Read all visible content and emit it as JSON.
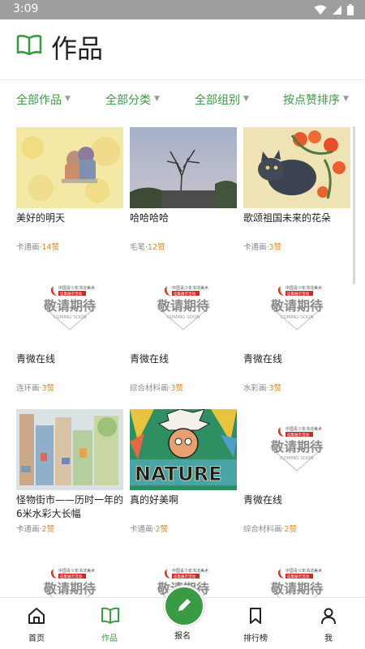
{
  "status": {
    "time": "3:09"
  },
  "header": {
    "title": "作品",
    "icon": "book-icon"
  },
  "filters": [
    "全部作品",
    "全部分类",
    "全部组别",
    "按点赞排序"
  ],
  "works": [
    {
      "title": "美好的明天",
      "category": "卡通画·",
      "likes": "14赞",
      "thumb": "painting-couple"
    },
    {
      "title": "哈哈哈哈",
      "category": "毛笔·",
      "likes": "12赞",
      "thumb": "photo-tree"
    },
    {
      "title": "歌颂祖国未来的花朵",
      "category": "卡通画·",
      "likes": "3赞",
      "thumb": "painting-cat"
    },
    {
      "title": "青微在线",
      "category": "连环画·",
      "likes": "3赞",
      "thumb": "coming-soon"
    },
    {
      "title": "青微在线",
      "category": "综合材料画·",
      "likes": "3赞",
      "thumb": "coming-soon"
    },
    {
      "title": "青微在线",
      "category": "水彩画·",
      "likes": "3赞",
      "thumb": "coming-soon"
    },
    {
      "title": "怪物街市——历时一年的6米水彩大长幅",
      "category": "卡通画·",
      "likes": "2赞",
      "thumb": "painting-street"
    },
    {
      "title": "真的好美啊",
      "category": "卡通画·",
      "likes": "2赞",
      "thumb": "painting-nature"
    },
    {
      "title": "青微在线",
      "category": "综合材料画·",
      "likes": "2赞",
      "thumb": "coming-soon"
    },
    {
      "title": "",
      "category": "",
      "likes": "",
      "thumb": "coming-soon"
    },
    {
      "title": "",
      "category": "",
      "likes": "",
      "thumb": "coming-soon"
    },
    {
      "title": "",
      "category": "",
      "likes": "",
      "thumb": "coming-soon"
    }
  ],
  "placeholder": {
    "big": "敬请期待",
    "small": "COMING SOON",
    "top": "中国青少年书法美术",
    "top2": "征集展示活动"
  },
  "nature_word": "NATURE",
  "nav": [
    {
      "label": "首页",
      "icon": "home-icon"
    },
    {
      "label": "作品",
      "icon": "book-icon"
    },
    {
      "label": "报名",
      "icon": "pencil-icon"
    },
    {
      "label": "排行榜",
      "icon": "bookmark-icon"
    },
    {
      "label": "我",
      "icon": "person-icon"
    }
  ],
  "colors": {
    "accent": "#3a9b45",
    "likes": "#e08a1e",
    "statusbar": "#9e9e9e"
  }
}
